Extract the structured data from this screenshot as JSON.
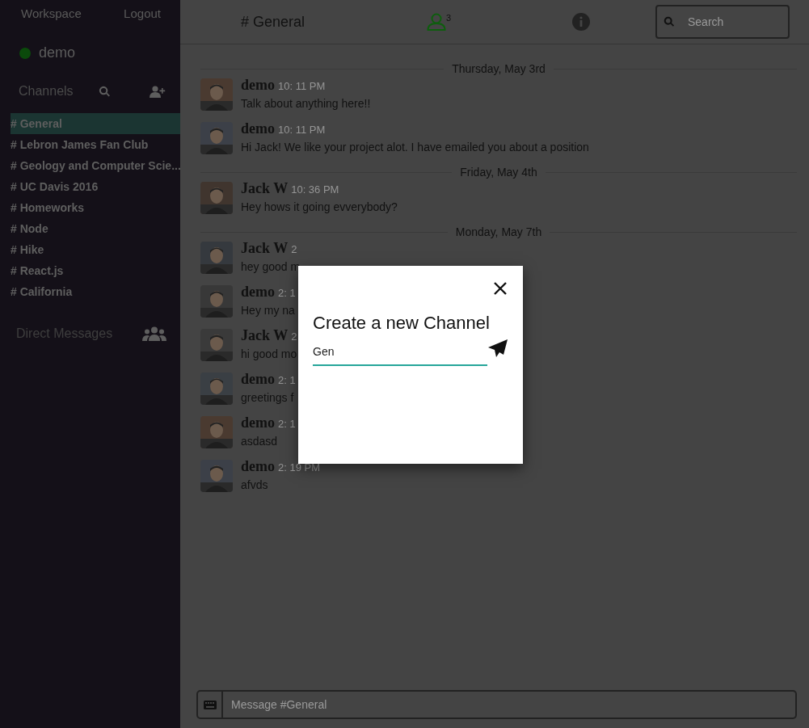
{
  "sidebar": {
    "top_links": [
      "Workspace",
      "Logout"
    ],
    "user": {
      "name": "demo",
      "online": true
    },
    "channels_heading": "Channels",
    "channels": [
      {
        "label": "# General",
        "selected": true
      },
      {
        "label": "# Lebron James Fan Club",
        "selected": false
      },
      {
        "label": "# Geology and Computer Scie...",
        "selected": false
      },
      {
        "label": "# UC Davis 2016",
        "selected": false
      },
      {
        "label": "# Homeworks",
        "selected": false
      },
      {
        "label": "# Node",
        "selected": false
      },
      {
        "label": "# Hike",
        "selected": false
      },
      {
        "label": "# React.js",
        "selected": false
      },
      {
        "label": "# California",
        "selected": false
      }
    ],
    "direct_messages_heading": "Direct Messages"
  },
  "header": {
    "channel": "# General",
    "member_count": "3",
    "search": {
      "placeholder": "Search"
    }
  },
  "messages": [
    {
      "kind": "date",
      "label": "Thursday, May 3rd"
    },
    {
      "kind": "message",
      "author": "demo",
      "time": "10: 11 PM",
      "text": "Talk about anything here!!"
    },
    {
      "kind": "message",
      "author": "demo",
      "time": "10: 11 PM",
      "text": "Hi Jack! We like your project alot. I have emailed you about a position"
    },
    {
      "kind": "date",
      "label": "Friday, May 4th"
    },
    {
      "kind": "message",
      "author": "Jack W",
      "time": "10: 36 PM",
      "text": "Hey hows it going evverybody?"
    },
    {
      "kind": "date",
      "label": "Monday, May 7th"
    },
    {
      "kind": "message",
      "author": "Jack W",
      "time": "2",
      "text": "hey good m"
    },
    {
      "kind": "message",
      "author": "demo",
      "time": "2: 1",
      "text": "Hey my na"
    },
    {
      "kind": "message",
      "author": "Jack W",
      "time": "2",
      "text": "hi good mo"
    },
    {
      "kind": "message",
      "author": "demo",
      "time": "2: 1",
      "text": "greetings f"
    },
    {
      "kind": "message",
      "author": "demo",
      "time": "2: 1",
      "text": "asdasd"
    },
    {
      "kind": "message",
      "author": "demo",
      "time": "2: 19 PM",
      "text": "afvds"
    }
  ],
  "composer": {
    "placeholder": "Message #General"
  },
  "modal": {
    "title": "Create a new Channel",
    "value": "Gen"
  }
}
